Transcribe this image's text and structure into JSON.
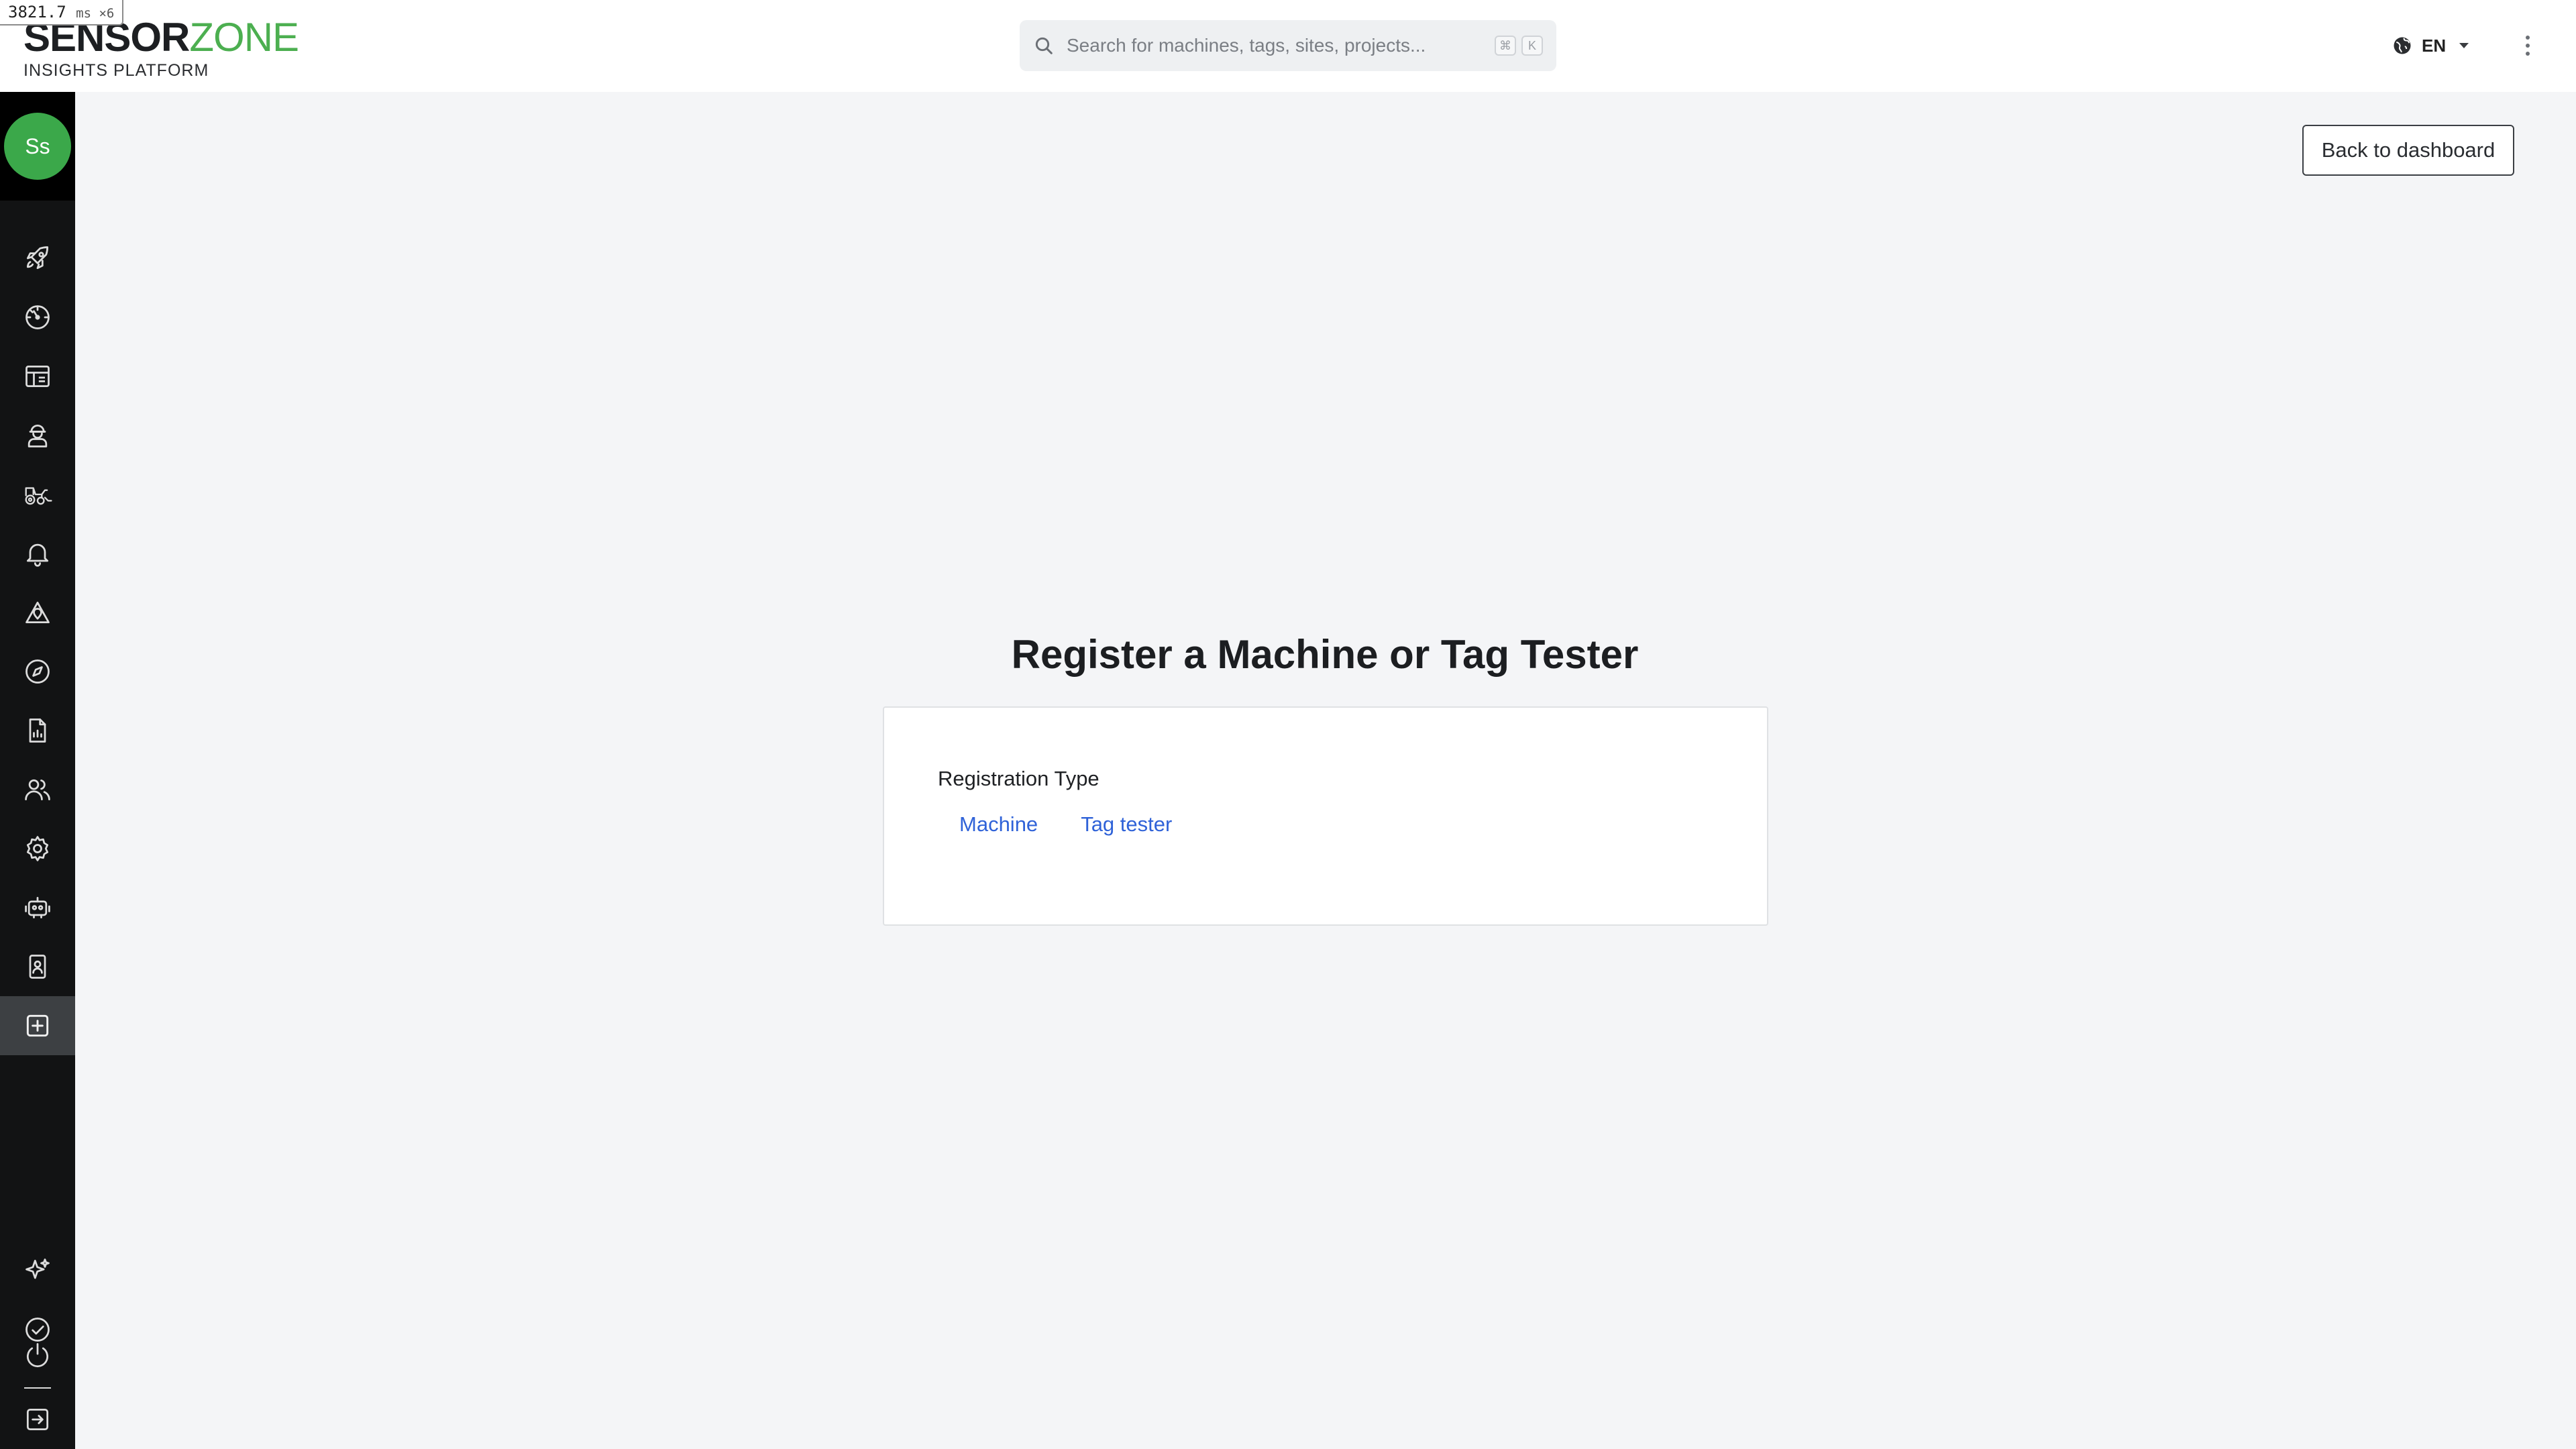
{
  "debug": {
    "timing_value": "3821.7",
    "timing_unit": "ms ×6"
  },
  "brand": {
    "name_part1": "SENSOR",
    "name_part2": "ZONE",
    "tagline": "INSIGHTS PLATFORM",
    "accent_color": "#4caf50"
  },
  "search": {
    "placeholder": "Search for machines, tags, sites, projects...",
    "shortcut_key1": "⌘",
    "shortcut_key2": "K"
  },
  "header": {
    "language": "EN"
  },
  "user": {
    "initials": "Ss",
    "avatar_color": "#3ba84a"
  },
  "sidebar": {
    "items": [
      {
        "icon": "rocket-icon"
      },
      {
        "icon": "gauge-icon"
      },
      {
        "icon": "dashboard-layout-icon"
      },
      {
        "icon": "worker-icon"
      },
      {
        "icon": "tractor-icon"
      },
      {
        "icon": "bell-icon"
      },
      {
        "icon": "site-marker-icon"
      },
      {
        "icon": "compass-icon"
      },
      {
        "icon": "report-file-icon"
      },
      {
        "icon": "users-icon"
      },
      {
        "icon": "settings-gear-icon"
      },
      {
        "icon": "robot-icon"
      },
      {
        "icon": "id-badge-icon"
      },
      {
        "icon": "add-square-icon",
        "active": true
      }
    ],
    "bottom_items": [
      {
        "icon": "sparkles-icon"
      },
      {
        "icon": "check-circle-icon"
      },
      {
        "icon": "power-icon"
      },
      {
        "icon": "logout-icon"
      }
    ]
  },
  "main": {
    "back_label": "Back to dashboard",
    "title": "Register a Machine or Tag Tester",
    "form": {
      "field_label": "Registration Type",
      "options": [
        "Machine",
        "Tag tester"
      ]
    }
  },
  "colors": {
    "link": "#2f62d8",
    "sidebar_bg": "#121314",
    "active_nav": "#3d4043"
  }
}
